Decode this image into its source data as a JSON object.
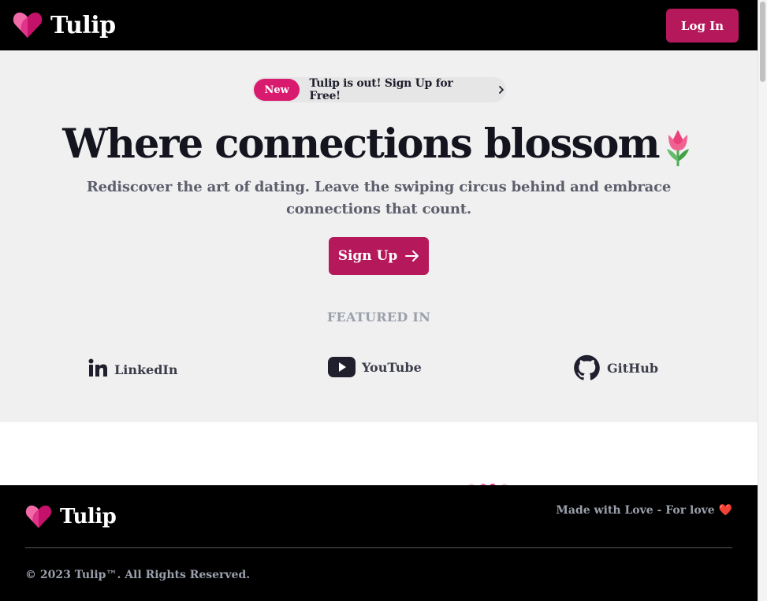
{
  "brand": {
    "name": "Tulip"
  },
  "header": {
    "login_label": "Log In"
  },
  "hero": {
    "badge": "New",
    "announcement": "Tulip is out! Sign Up for Free!",
    "headline": "Where connections blossom",
    "subtitle": "Rediscover the art of dating. Leave the swiping circus behind and embrace connections that count.",
    "signup_label": "Sign Up"
  },
  "featured": {
    "title": "FEATURED IN",
    "items": [
      {
        "label": "LinkedIn",
        "icon": "linkedin-icon"
      },
      {
        "label": "YouTube",
        "icon": "youtube-icon"
      },
      {
        "label": "GitHub",
        "icon": "github-icon"
      }
    ]
  },
  "footer": {
    "tagline": "Made with Love - For love ❤️",
    "copyright": "© 2023 Tulip™. All Rights Reserved."
  },
  "colors": {
    "accent": "#b5195b",
    "badge": "#d81b6f",
    "header_bg": "#000000",
    "hero_bg": "#f0f0f0",
    "muted_text": "#9aa0ab"
  }
}
